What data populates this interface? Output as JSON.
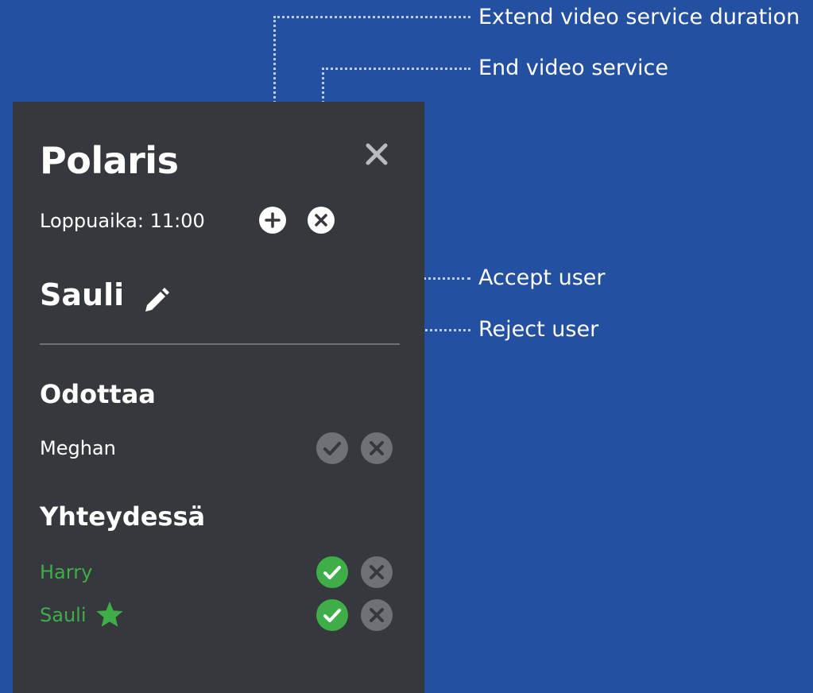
{
  "annotations": {
    "extend_label": "Extend video service duration",
    "end_label": "End video service",
    "accept_label": "Accept user",
    "reject_label": "Reject user"
  },
  "panel": {
    "title": "Polaris",
    "end_time_label": "Loppuaika: 11:00",
    "current_user": "Sauli",
    "waiting_heading": "Odottaa",
    "connected_heading": "Yhteydessä",
    "waiting_users": [
      "Meghan"
    ],
    "connected_users": [
      "Harry",
      "Sauli"
    ]
  },
  "icons": {
    "close": "close-icon",
    "extend": "plus-circle-icon",
    "end": "x-circle-icon",
    "edit": "pencil-icon",
    "accept": "check-circle-icon",
    "reject": "x-circle-icon",
    "host": "star-icon"
  },
  "colors": {
    "background": "#2350a0",
    "panel": "#35383d",
    "connected_green": "#3fae49",
    "inactive_grey": "#6e7277",
    "annotation_line": "#b8ccf0"
  }
}
